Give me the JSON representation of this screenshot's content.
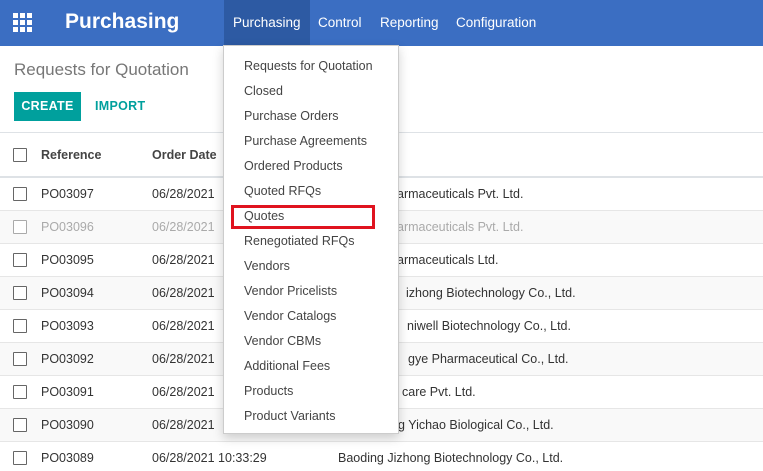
{
  "navbar": {
    "brand": "Purchasing",
    "menus": [
      "Purchasing",
      "Control",
      "Reporting",
      "Configuration"
    ]
  },
  "control_panel": {
    "title": "Requests for Quotation",
    "create_label": "CREATE",
    "import_label": "IMPORT"
  },
  "table": {
    "headers": {
      "reference": "Reference",
      "order_date": "Order Date"
    },
    "rows": [
      {
        "ref": "PO03097",
        "date": "06/28/2021",
        "vendor": "armaceuticals Pvt. Ltd."
      },
      {
        "ref": "PO03096",
        "date": "06/28/2021",
        "vendor": "armaceuticals Pvt. Ltd."
      },
      {
        "ref": "PO03095",
        "date": "06/28/2021",
        "vendor": "armaceuticals Ltd."
      },
      {
        "ref": "PO03094",
        "date": "06/28/2021",
        "vendor": "izhong Biotechnology Co., Ltd."
      },
      {
        "ref": "PO03093",
        "date": "06/28/2021",
        "vendor": "niwell Biotechnology Co., Ltd."
      },
      {
        "ref": "PO03092",
        "date": "06/28/2021",
        "vendor": "gye Pharmaceutical Co., Ltd."
      },
      {
        "ref": "PO03091",
        "date": "06/28/2021",
        "vendor": "care Pvt. Ltd."
      },
      {
        "ref": "PO03090",
        "date": "06/28/2021",
        "vendor": "g Yichao Biological Co., Ltd."
      },
      {
        "ref": "PO03089",
        "date": "06/28/2021 10:33:29",
        "vendor": "Baoding Jizhong Biotechnology Co., Ltd."
      }
    ]
  },
  "dropdown": {
    "items": [
      "Requests for Quotation",
      "Closed",
      "Purchase Orders",
      "Purchase Agreements",
      "Ordered Products",
      "Quoted RFQs",
      "Quotes",
      "Renegotiated RFQs",
      "Vendors",
      "Vendor Pricelists",
      "Vendor Catalogs",
      "Vendor CBMs",
      "Additional Fees",
      "Products",
      "Product Variants"
    ],
    "highlighted_item": "Quotes",
    "highlight_color": "#e0131f"
  },
  "colors": {
    "navbar": "#3b6ec2",
    "navbar_active": "#2d5aa3",
    "primary_button": "#00a09d"
  },
  "icons": {
    "apps": "apps-grid-icon"
  }
}
